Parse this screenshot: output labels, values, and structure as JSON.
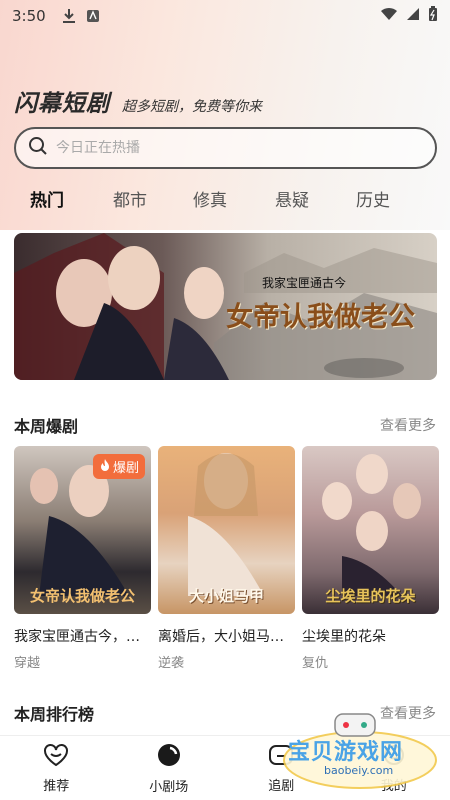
{
  "status_bar": {
    "time": "3:50"
  },
  "header": {
    "title": "闪幕短剧",
    "slogan": "超多短剧，免费等你来"
  },
  "search": {
    "placeholder": "今日正在热播"
  },
  "tabs": [
    {
      "label": "热门",
      "active": true
    },
    {
      "label": "都市"
    },
    {
      "label": "修真"
    },
    {
      "label": "悬疑"
    },
    {
      "label": "历史"
    }
  ],
  "banner": {
    "subtitle": "我家宝匣通古今",
    "title": "女帝认我做老公"
  },
  "weekly_hits": {
    "title": "本周爆剧",
    "see_more": "查看更多",
    "cards": [
      {
        "cover_text": "女帝认我做老公",
        "badge": "爆剧",
        "title": "我家宝匣通古今，…",
        "tag": "穿越"
      },
      {
        "cover_text": "大小姐马甲",
        "title": "离婚后，大小姐马…",
        "tag": "逆袭"
      },
      {
        "cover_text": "尘埃里的花朵",
        "title": "尘埃里的花朵",
        "tag": "复仇"
      }
    ]
  },
  "weekly_ranking": {
    "title": "本周排行榜",
    "see_more": "查看更多"
  },
  "bottom_nav": [
    {
      "label": "推荐",
      "icon": "heart-icon"
    },
    {
      "label": "小剧场",
      "icon": "theater-icon"
    },
    {
      "label": "追剧",
      "icon": "follow-icon"
    },
    {
      "label": "我的",
      "icon": "profile-icon"
    }
  ],
  "watermark": {
    "text": "宝贝游戏网",
    "url": "baobeiy.com"
  },
  "colors": {
    "accent": "#f05a3a",
    "badge": "#f26d3c"
  }
}
